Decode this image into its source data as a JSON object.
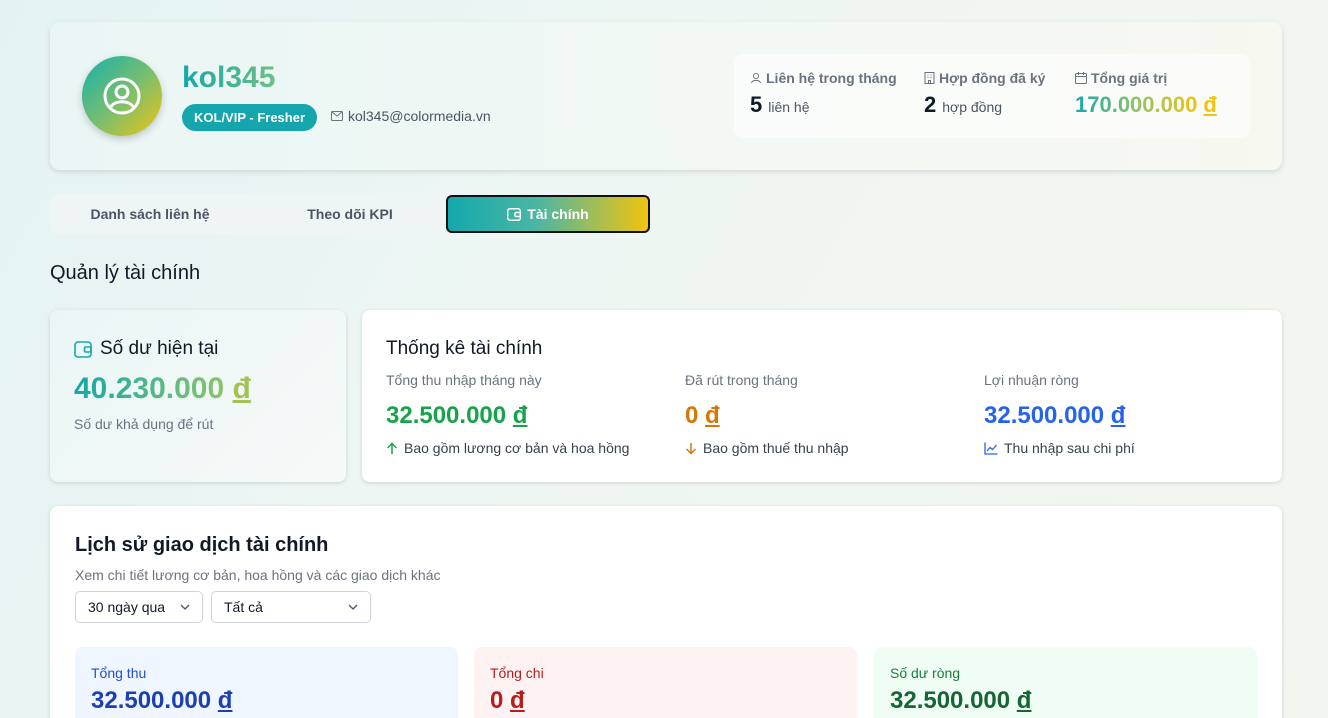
{
  "profile": {
    "username": "kol345",
    "badge": "KOL/VIP - Fresher",
    "email": "kol345@colormedia.vn",
    "stats": [
      {
        "label": "Liên hệ trong tháng",
        "value": "5",
        "unit": "liên hệ",
        "icon": "user-icon"
      },
      {
        "label": "Hợp đồng đã ký",
        "value": "2",
        "unit": "hợp đồng",
        "icon": "building-icon"
      },
      {
        "label": "Tổng giá trị",
        "value": "170.000.000",
        "currency": "đ",
        "icon": "calendar-icon"
      }
    ]
  },
  "tabs": [
    {
      "label": "Danh sách liên hệ"
    },
    {
      "label": "Theo dõi KPI"
    },
    {
      "label": "Tài chính",
      "active": true
    }
  ],
  "section_title": "Quản lý tài chính",
  "balance": {
    "title": "Số dư hiện tại",
    "amount": "40.230.000",
    "currency": "đ",
    "subtitle": "Số dư khả dụng để rút"
  },
  "finance_stats": {
    "title": "Thống kê tài chính",
    "columns": [
      {
        "label": "Tổng thu nhập tháng này",
        "amount": "32.500.000",
        "currency": "đ",
        "note": "Bao gồm lương cơ bản và hoa hồng",
        "icon": "arrow-up-icon",
        "color": "#16a34a"
      },
      {
        "label": "Đã rút trong tháng",
        "amount": "0",
        "currency": "đ",
        "note": "Bao gồm thuế thu nhập",
        "icon": "arrow-down-icon",
        "color": "#d97706"
      },
      {
        "label": "Lợi nhuận ròng",
        "amount": "32.500.000",
        "currency": "đ",
        "note": "Thu nhập sau chi phí",
        "icon": "trend-chart-icon",
        "color": "#2563eb"
      }
    ]
  },
  "history": {
    "title": "Lịch sử giao dịch tài chính",
    "subtitle": "Xem chi tiết lương cơ bản, hoa hồng và các giao dịch khác",
    "filters": [
      {
        "value": "30 ngày qua"
      },
      {
        "value": "Tất cả"
      }
    ],
    "summaries": [
      {
        "label": "Tổng thu",
        "amount": "32.500.000",
        "currency": "đ",
        "bg": "#eff6ff",
        "label_color": "#1d4ed8",
        "amount_color": "#1e40af"
      },
      {
        "label": "Tổng chi",
        "amount": "0",
        "currency": "đ",
        "bg": "#fef2f2",
        "label_color": "#b91c1c",
        "amount_color": "#b91c1c"
      },
      {
        "label": "Số dư ròng",
        "amount": "32.500.000",
        "currency": "đ",
        "bg": "#f0fdf4",
        "label_color": "#15803d",
        "amount_color": "#166534"
      }
    ]
  }
}
